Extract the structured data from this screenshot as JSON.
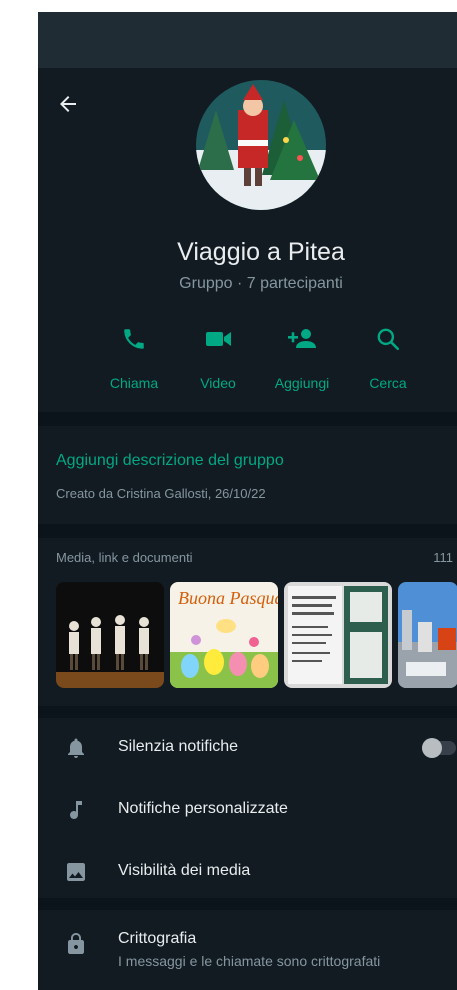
{
  "group": {
    "name": "Viaggio a Pitea",
    "subtitle": "Gruppo · 7 partecipanti"
  },
  "actions": [
    {
      "label": "Chiama",
      "icon": "phone-icon"
    },
    {
      "label": "Video",
      "icon": "video-icon"
    },
    {
      "label": "Aggiungi",
      "icon": "add-person-icon"
    },
    {
      "label": "Cerca",
      "icon": "search-icon"
    }
  ],
  "description": {
    "link": "Aggiungi descrizione del gruppo",
    "created": "Creato da Cristina Gallosti, 26/10/22"
  },
  "media": {
    "title": "Media, link e documenti",
    "count": "111",
    "thumb2_text": "Buona Pasqua"
  },
  "settings": {
    "mute": "Silenzia notifiche",
    "mute_enabled": false,
    "custom_notifications": "Notifiche personalizzate",
    "media_visibility": "Visibilità dei media",
    "encryption_title": "Crittografia",
    "encryption_desc": "I messaggi e le chiamate sono crittografati"
  },
  "colors": {
    "accent": "#00a884",
    "background": "#111b21",
    "divider": "#0b141a",
    "text_primary": "#e9edef",
    "text_secondary": "#8696a0"
  }
}
